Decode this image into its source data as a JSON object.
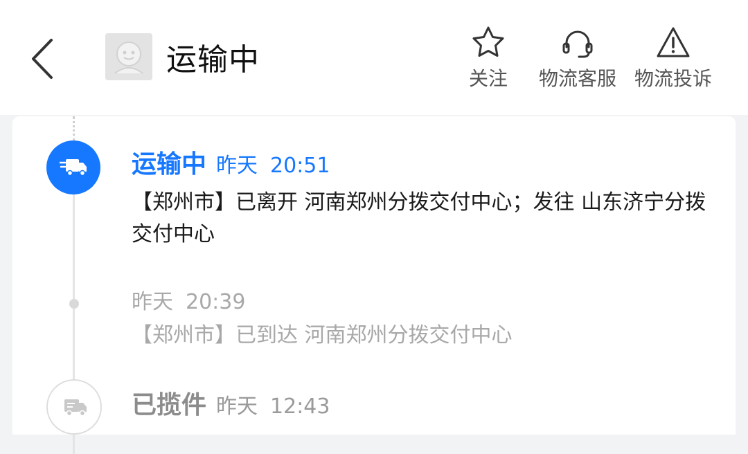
{
  "header": {
    "title": "运输中",
    "actions": [
      {
        "label": "关注",
        "icon": "star-icon"
      },
      {
        "label": "物流客服",
        "icon": "headset-icon"
      },
      {
        "label": "物流投诉",
        "icon": "warning-icon"
      }
    ]
  },
  "timeline": {
    "events": [
      {
        "status": "运输中",
        "date": "昨天",
        "time": "20:51",
        "description": "【郑州市】已离开 河南郑州分拨交付中心；发往 山东济宁分拨交付中心",
        "icon": "truck-icon"
      },
      {
        "status": "",
        "date": "昨天",
        "time": "20:39",
        "description": "【郑州市】已到达 河南郑州分拨交付中心"
      },
      {
        "status": "已揽件",
        "date": "昨天",
        "time": "12:43",
        "icon": "truck-icon"
      }
    ]
  },
  "colors": {
    "accent": "#1677ff",
    "muted": "#a8a8a8",
    "text": "#1a1a1a"
  }
}
